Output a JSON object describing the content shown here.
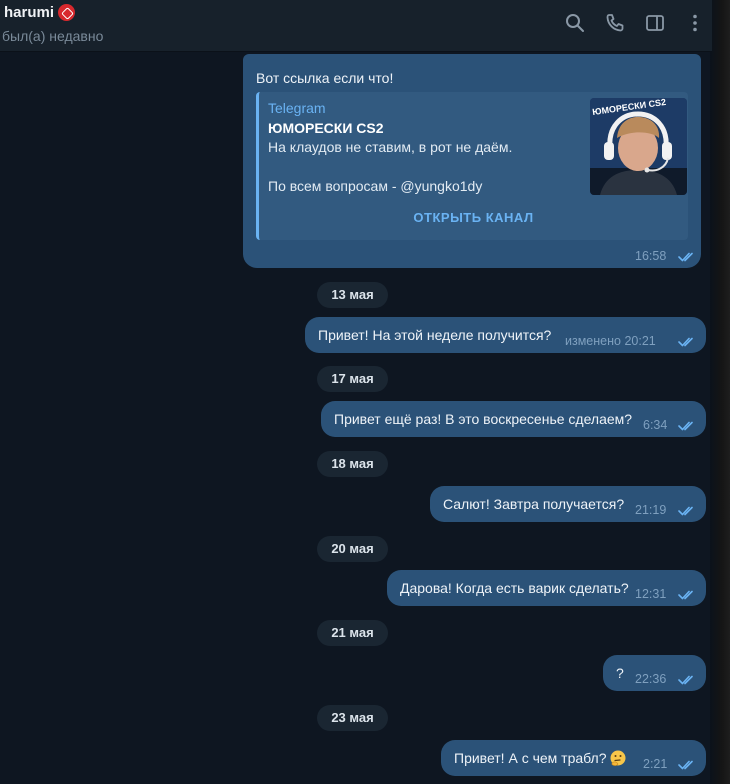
{
  "header": {
    "name": "harumi",
    "status": "был(а) недавно",
    "icons": [
      "search-icon",
      "phone-icon",
      "sidebar-toggle-icon",
      "more-icon"
    ]
  },
  "colors": {
    "background": "#0e1621",
    "header": "#17212b",
    "outgoing_bubble": "#2b5278",
    "accent": "#6ab3f3",
    "date_pill": "#1a2632"
  },
  "first_message": {
    "text": "Вот ссылка если что!",
    "time": "16:58",
    "preview": {
      "site": "Telegram",
      "title": "ЮМОРЕСКИ CS2",
      "desc1": "На клаудов не ставим, в рот не даём.",
      "desc2": "По всем вопросам - @yungko1dy",
      "thumb_label": "ЮМОРЕСКИ CS2",
      "button": "ОТКРЫТЬ КАНАЛ"
    }
  },
  "dates": [
    "13 мая",
    "17 мая",
    "18 мая",
    "20 мая",
    "21 мая",
    "23 мая"
  ],
  "messages": [
    {
      "text": "Привет! На этой неделе получится?",
      "time": "изменено 20:21"
    },
    {
      "text": "Привет ещё раз! В это воскресенье сделаем?",
      "time": "6:34"
    },
    {
      "text": "Салют! Завтра получается?",
      "time": "21:19"
    },
    {
      "text": "Дарова! Когда есть варик сделать?",
      "time": "12:31"
    },
    {
      "text": "?",
      "time": "22:36"
    },
    {
      "text": "Привет! А с чем трабл?",
      "time": "2:21"
    }
  ]
}
